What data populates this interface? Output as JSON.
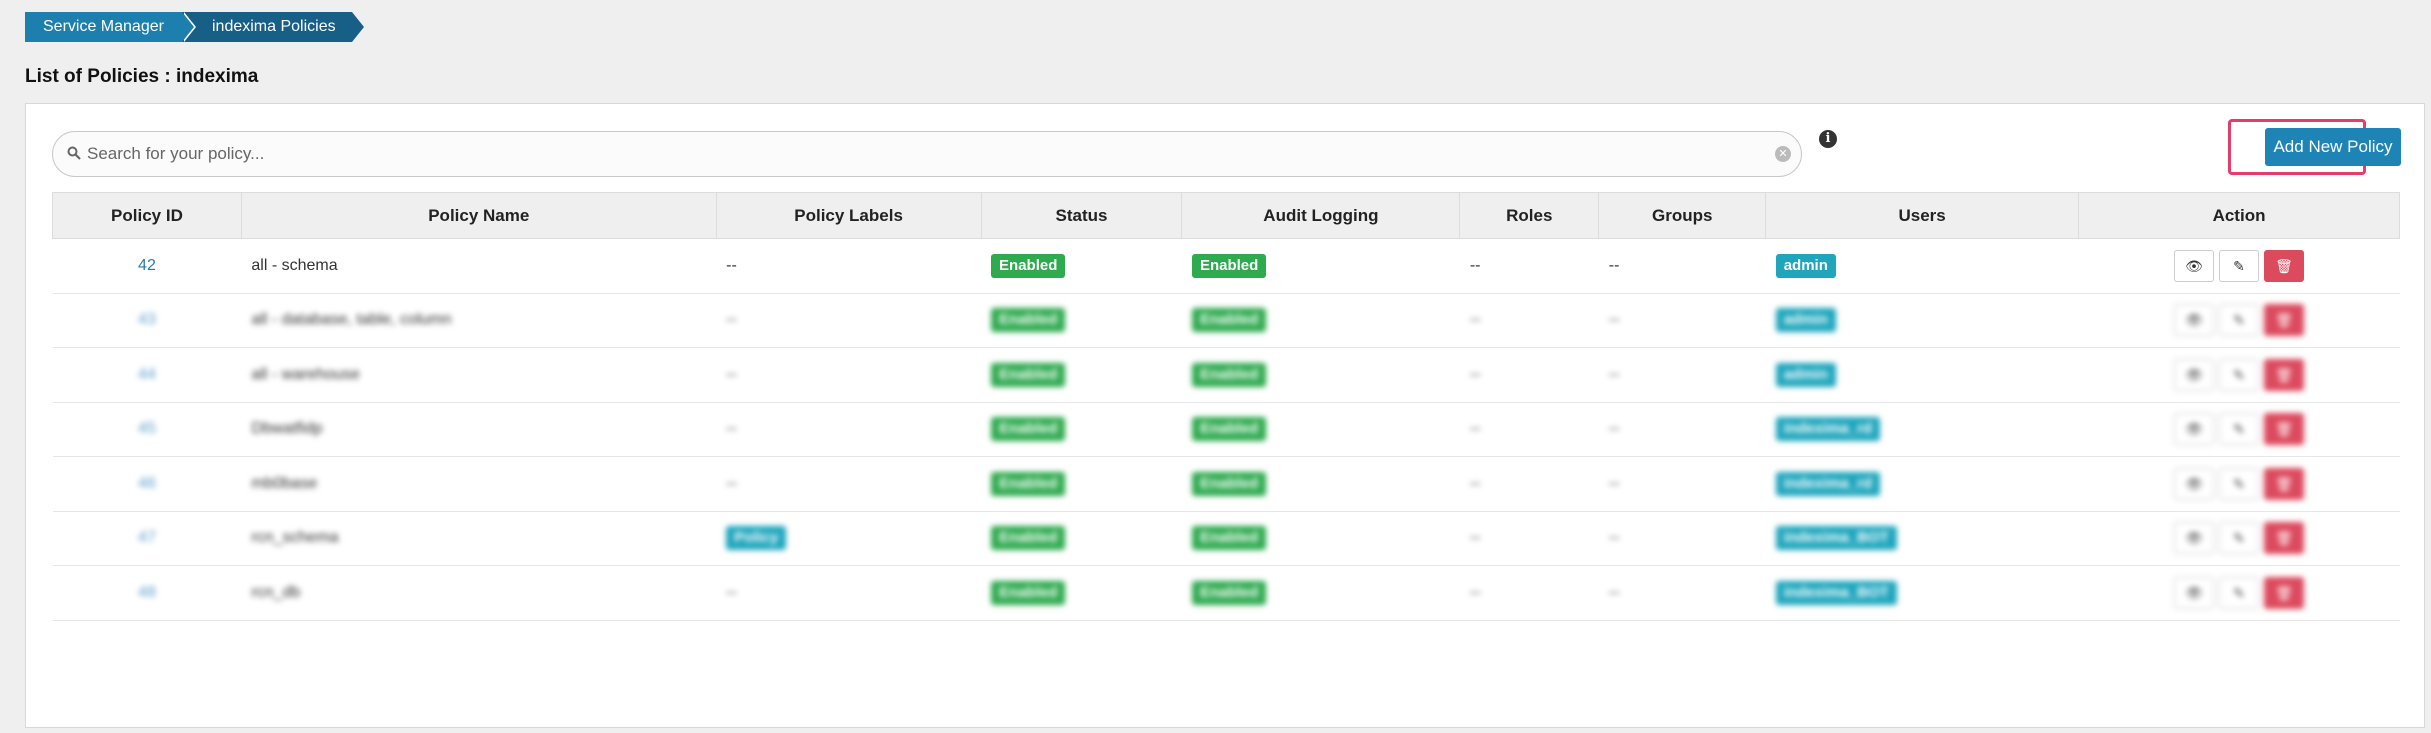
{
  "breadcrumb": {
    "items": [
      "Service Manager",
      "indexima Policies"
    ]
  },
  "page_title": "List of Policies : indexima",
  "search": {
    "placeholder": "Search for your policy..."
  },
  "add_button": "Add New Policy",
  "table": {
    "columns": [
      "Policy ID",
      "Policy Name",
      "Policy Labels",
      "Status",
      "Audit Logging",
      "Roles",
      "Groups",
      "Users",
      "Action"
    ],
    "rows": [
      {
        "id": "42",
        "name": "all - schema",
        "labels": "--",
        "status": "Enabled",
        "audit": "Enabled",
        "roles": "--",
        "groups": "--",
        "users": "admin"
      },
      {
        "id": "43",
        "name": "all - database, table, column",
        "labels": "--",
        "status": "Enabled",
        "audit": "Enabled",
        "roles": "--",
        "groups": "--",
        "users": "admin"
      },
      {
        "id": "44",
        "name": "all - warehouse",
        "labels": "--",
        "status": "Enabled",
        "audit": "Enabled",
        "roles": "--",
        "groups": "--",
        "users": "admin"
      },
      {
        "id": "45",
        "name": "Dbwatfidp",
        "labels": "--",
        "status": "Enabled",
        "audit": "Enabled",
        "roles": "--",
        "groups": "--",
        "users": "indexima_rd"
      },
      {
        "id": "46",
        "name": "mb0base",
        "labels": "--",
        "status": "Enabled",
        "audit": "Enabled",
        "roles": "--",
        "groups": "--",
        "users": "indexima_rd"
      },
      {
        "id": "47",
        "name": "rcn_schema",
        "labels": "Policy",
        "status": "Enabled",
        "audit": "Enabled",
        "roles": "--",
        "groups": "--",
        "users": "indexima_BOT"
      },
      {
        "id": "48",
        "name": "rcn_db",
        "labels": "--",
        "status": "Enabled",
        "audit": "Enabled",
        "roles": "--",
        "groups": "--",
        "users": "indexima_BOT"
      }
    ]
  },
  "icons": {
    "view": "eye-icon",
    "edit": "edit-icon",
    "delete": "trash-icon",
    "search": "search-icon",
    "info": "info-icon",
    "clear": "clear-icon"
  },
  "colors": {
    "primary": "#1d84b5",
    "enabled": "#2eaa4f",
    "user_badge": "#1fa6bd",
    "delete": "#dc4a5e",
    "highlight": "#e43d6a"
  }
}
